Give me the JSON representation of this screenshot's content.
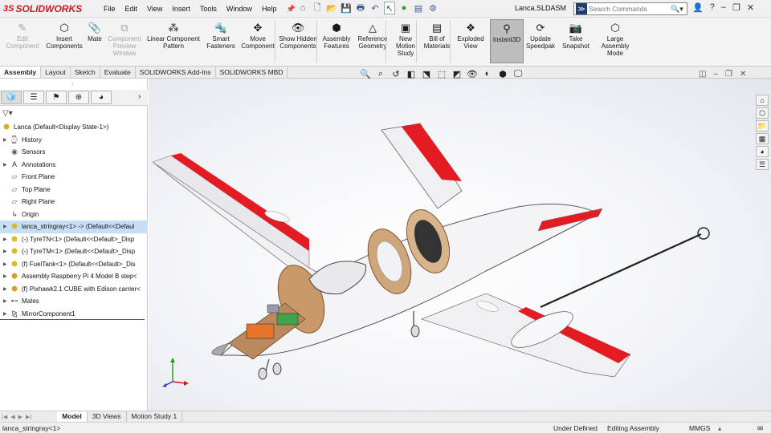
{
  "app": {
    "logo_prefix": "3S",
    "logo_name": "SOLIDWORKS",
    "document_title": "Lanca.SLDASM"
  },
  "menu": [
    "File",
    "Edit",
    "View",
    "Insert",
    "Tools",
    "Window",
    "Help"
  ],
  "search": {
    "placeholder": "Search Commands"
  },
  "ribbon": [
    {
      "label": "Edit Component",
      "icon": "edit-component-icon",
      "glyph": "✎",
      "disabled": true
    },
    {
      "label": "Insert Components",
      "icon": "insert-components-icon",
      "glyph": "⬡",
      "disabled": false
    },
    {
      "label": "Mate",
      "icon": "mate-icon",
      "glyph": "📎",
      "disabled": false
    },
    {
      "label": "Component Preview Window",
      "icon": "component-preview-icon",
      "glyph": "⧉",
      "disabled": true
    },
    {
      "label": "Linear Component Pattern",
      "icon": "linear-pattern-icon",
      "glyph": "⁂",
      "disabled": false
    },
    {
      "label": "Smart Fasteners",
      "icon": "smart-fasteners-icon",
      "glyph": "🔩",
      "disabled": false
    },
    {
      "label": "Move Component",
      "icon": "move-component-icon",
      "glyph": "✥",
      "disabled": false
    },
    {
      "label": "Show Hidden Components",
      "icon": "show-hidden-icon",
      "glyph": "👁",
      "disabled": false
    },
    {
      "label": "Assembly Features",
      "icon": "assembly-features-icon",
      "glyph": "⬢",
      "disabled": false
    },
    {
      "label": "Reference Geometry",
      "icon": "reference-geometry-icon",
      "glyph": "△",
      "disabled": false
    },
    {
      "label": "New Motion Study",
      "icon": "motion-study-icon",
      "glyph": "▣",
      "disabled": false
    },
    {
      "label": "Bill of Materials",
      "icon": "bom-icon",
      "glyph": "▤",
      "disabled": false
    },
    {
      "label": "Exploded View",
      "icon": "exploded-view-icon",
      "glyph": "❖",
      "disabled": false
    },
    {
      "label": "Instant3D",
      "icon": "instant3d-icon",
      "glyph": "⚲",
      "disabled": false,
      "active": true
    },
    {
      "label": "Update Speedpak",
      "icon": "speedpak-icon",
      "glyph": "⟳",
      "disabled": false
    },
    {
      "label": "Take Snapshot",
      "icon": "snapshot-icon",
      "glyph": "📷",
      "disabled": false
    },
    {
      "label": "Large Assembly Mode",
      "icon": "large-assembly-icon",
      "glyph": "⬡",
      "disabled": false
    }
  ],
  "command_tabs": [
    "Assembly",
    "Layout",
    "Sketch",
    "Evaluate",
    "SOLIDWORKS Add-Ins",
    "SOLIDWORKS MBD"
  ],
  "tree": [
    {
      "label": "Lanca  (Default<Display State-1>)",
      "icon": "assembly-icon",
      "expand": false,
      "indent": 0
    },
    {
      "label": "History",
      "icon": "history-icon",
      "expand": true,
      "indent": 1
    },
    {
      "label": "Sensors",
      "icon": "sensors-icon",
      "expand": false,
      "indent": 1
    },
    {
      "label": "Annotations",
      "icon": "annotations-icon",
      "expand": true,
      "indent": 1
    },
    {
      "label": "Front Plane",
      "icon": "plane-icon",
      "expand": false,
      "indent": 1
    },
    {
      "label": "Top Plane",
      "icon": "plane-icon",
      "expand": false,
      "indent": 1
    },
    {
      "label": "Right Plane",
      "icon": "plane-icon",
      "expand": false,
      "indent": 1
    },
    {
      "label": "Origin",
      "icon": "origin-icon",
      "expand": false,
      "indent": 1
    },
    {
      "label": "lanca_stringray<1> -> (Default<<Defaul",
      "icon": "part-icon",
      "expand": true,
      "indent": 1,
      "selected": true
    },
    {
      "label": "(-) TyreTN<1> (Default<<Default>_Disp",
      "icon": "part-icon",
      "expand": true,
      "indent": 1
    },
    {
      "label": "(-) TyreTM<1> (Default<<Default>_Disp",
      "icon": "part-icon",
      "expand": true,
      "indent": 1
    },
    {
      "label": "(f) FuelTank<1> (Default<<Default>_Dis",
      "icon": "part-icon",
      "expand": true,
      "indent": 1
    },
    {
      "label": "Assembly Raspberry Pi 4 Model B step<",
      "icon": "subassembly-icon",
      "expand": true,
      "indent": 1
    },
    {
      "label": "(f) Pixhawk2.1 CUBE with Edison carrier<",
      "icon": "subassembly-icon",
      "expand": true,
      "indent": 1
    },
    {
      "label": "Mates",
      "icon": "mates-icon",
      "expand": true,
      "indent": 1
    },
    {
      "label": "MirrorComponent1",
      "icon": "mirror-icon",
      "expand": true,
      "indent": 1
    }
  ],
  "bottom_tabs": [
    "Model",
    "3D Views",
    "Motion Study 1"
  ],
  "status": {
    "selection": "lanca_stringray<1>",
    "definition": "Under Defined",
    "mode": "Editing Assembly",
    "units": "MMGS"
  },
  "colors": {
    "accent_red": "#d5171c",
    "selection": "#c7dff6",
    "wood": "#c8a07a"
  }
}
